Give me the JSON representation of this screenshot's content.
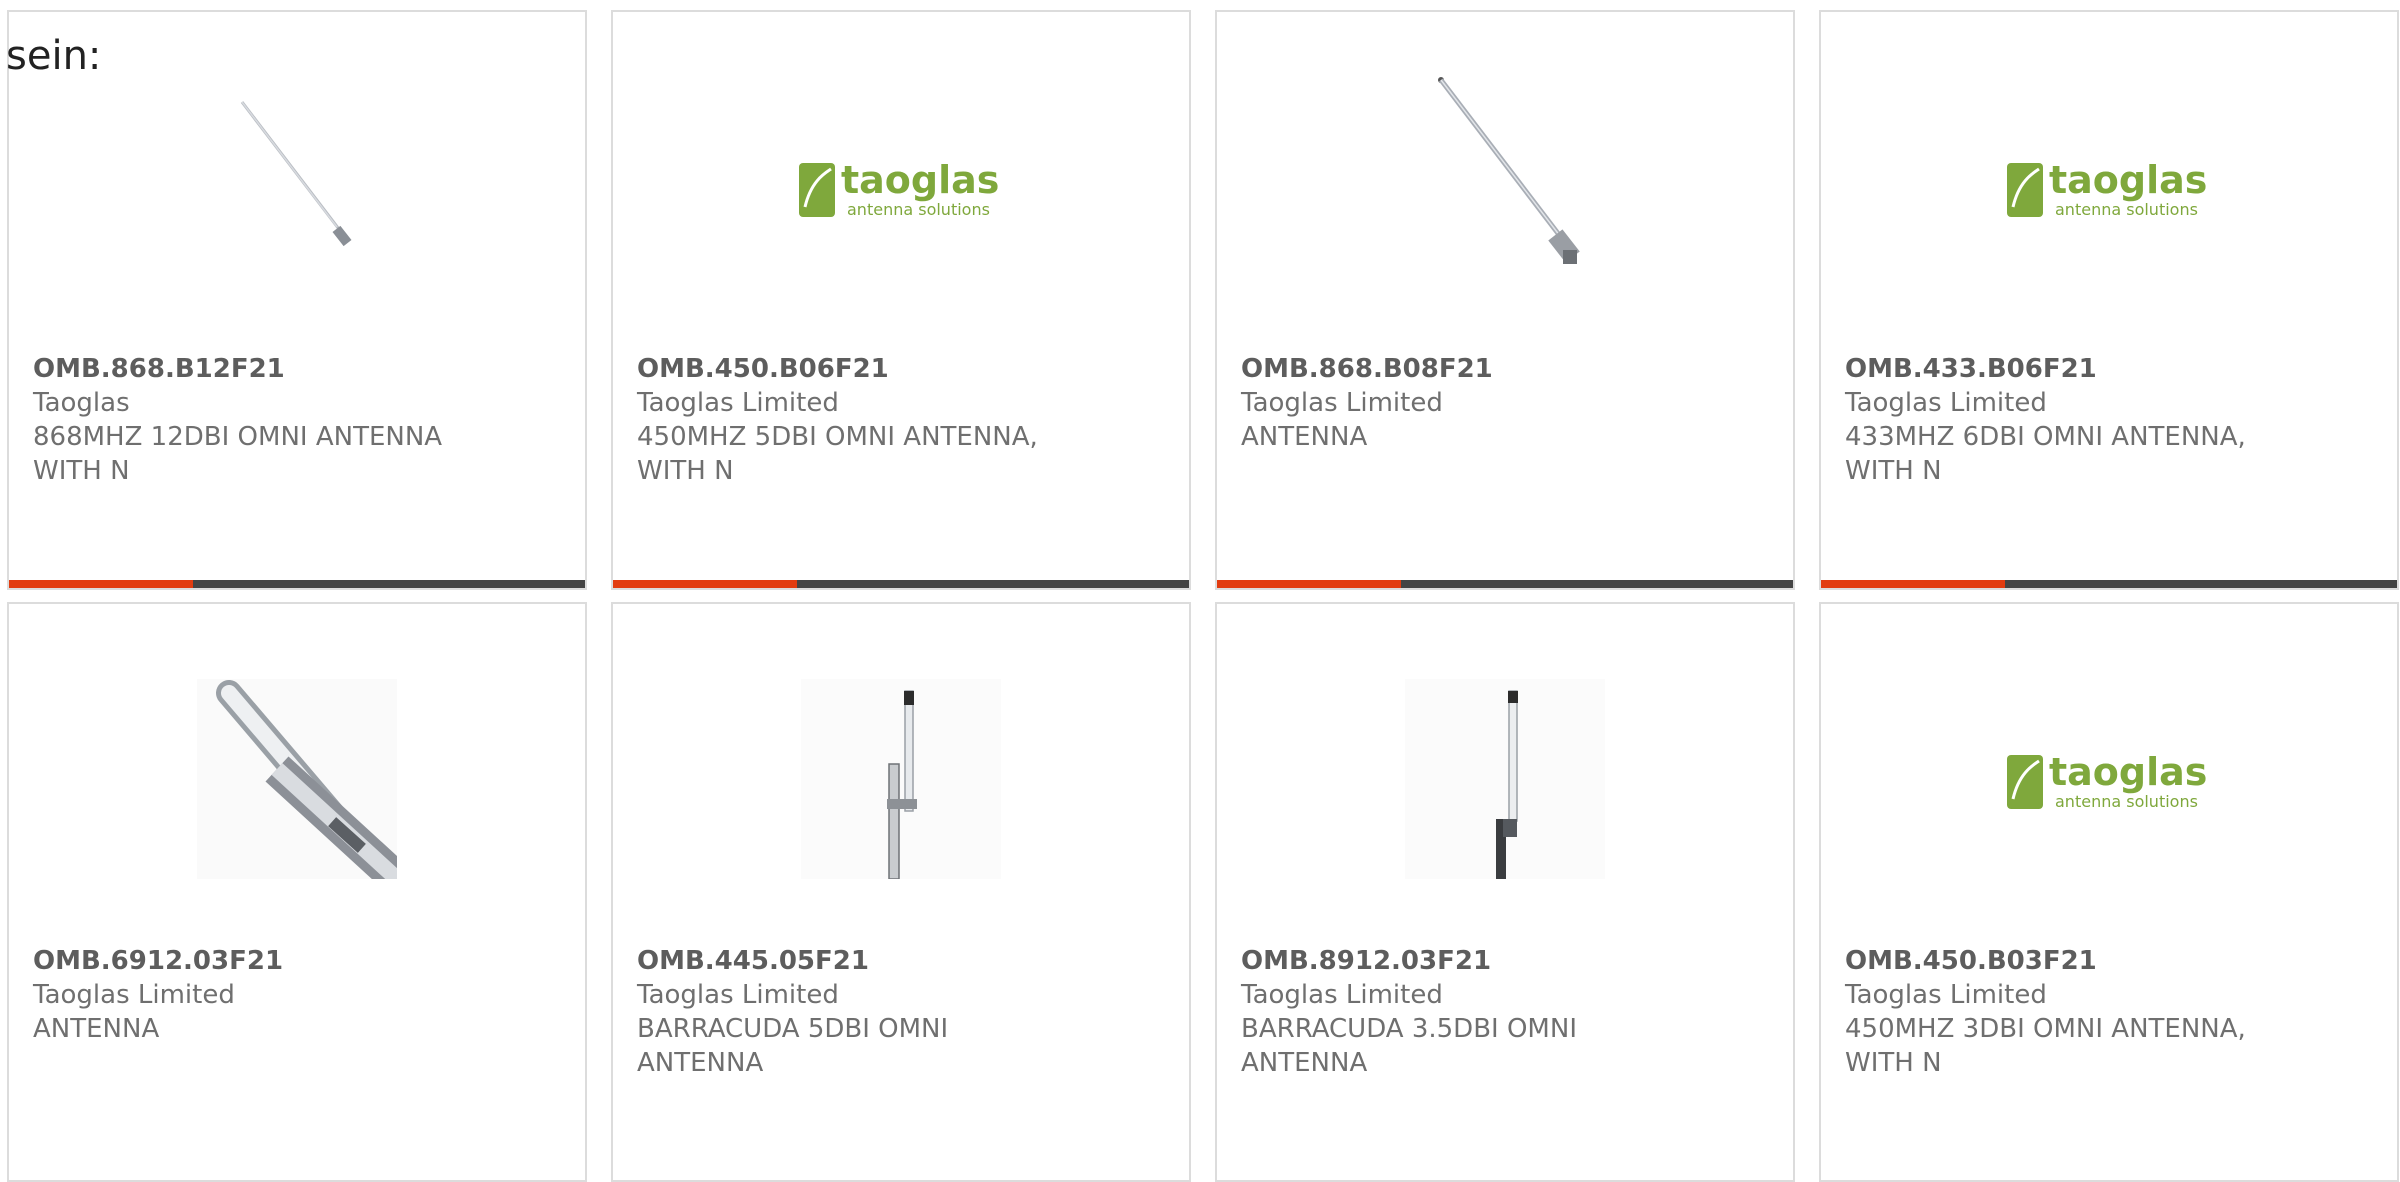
{
  "intro_text": "sein:",
  "colors": {
    "accent": "#e23c10",
    "bar": "#444444",
    "logo_green": "#7fa83c"
  },
  "logo": {
    "name": "taoglas",
    "tagline": "antenna solutions"
  },
  "products": [
    {
      "part_number": "OMB.868.B12F21",
      "manufacturer": "Taoglas",
      "description": "868MHZ 12DBI OMNI ANTENNA WITH N",
      "image": "thin-omni-antenna-icon",
      "accent_fraction": 0.32
    },
    {
      "part_number": "OMB.450.B06F21",
      "manufacturer": "Taoglas Limited",
      "description": "450MHZ 5DBI OMNI ANTENNA, WITH N",
      "image": "taoglas-logo",
      "accent_fraction": 0.32
    },
    {
      "part_number": "OMB.868.B08F21",
      "manufacturer": "Taoglas Limited",
      "description": "ANTENNA",
      "image": "long-omni-antenna-icon",
      "accent_fraction": 0.32
    },
    {
      "part_number": "OMB.433.B06F21",
      "manufacturer": "Taoglas Limited",
      "description": "433MHZ 6DBI OMNI ANTENNA, WITH N",
      "image": "taoglas-logo",
      "accent_fraction": 0.32
    },
    {
      "part_number": "OMB.6912.03F21",
      "manufacturer": "Taoglas Limited",
      "description": "ANTENNA",
      "image": "barracuda-closeup-icon"
    },
    {
      "part_number": "OMB.445.05F21",
      "manufacturer": "Taoglas Limited",
      "description": "BARRACUDA 5DBI OMNI ANTENNA",
      "image": "vertical-mast-antenna-icon"
    },
    {
      "part_number": "OMB.8912.03F21",
      "manufacturer": "Taoglas Limited",
      "description": "BARRACUDA 3.5DBI OMNI ANTENNA",
      "image": "vertical-mast-antenna-icon"
    },
    {
      "part_number": "OMB.450.B03F21",
      "manufacturer": "Taoglas Limited",
      "description": "450MHZ 3DBI OMNI ANTENNA, WITH N",
      "image": "taoglas-logo"
    }
  ]
}
